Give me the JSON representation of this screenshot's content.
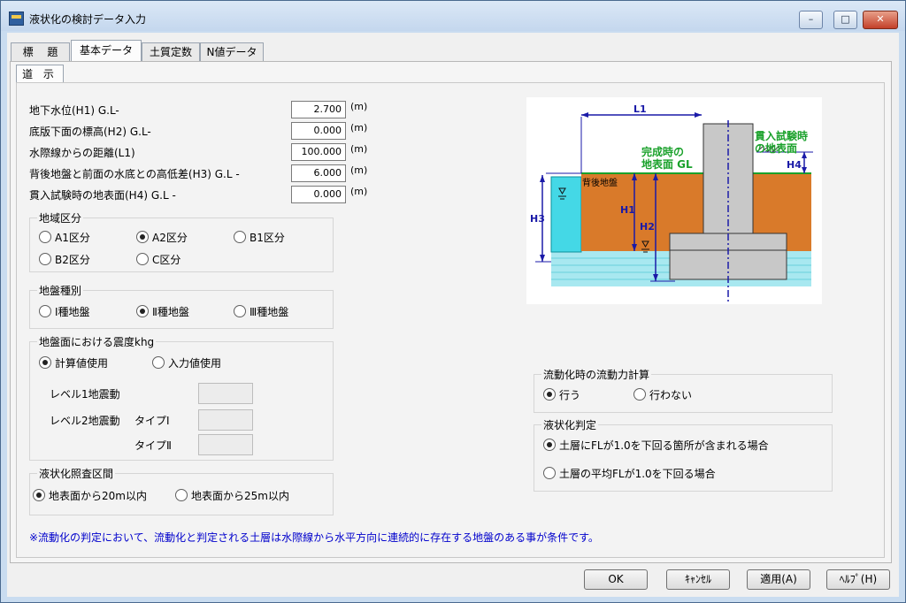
{
  "window": {
    "title": "液状化の検討データ入力"
  },
  "tabs": [
    {
      "label": "標　 題"
    },
    {
      "label": "基本データ"
    },
    {
      "label": "土質定数"
    },
    {
      "label": "N値データ"
    }
  ],
  "subtab": "道 示",
  "fields": [
    {
      "label": "地下水位(H1)  G.L-",
      "value": "2.700",
      "unit": "(m)"
    },
    {
      "label": "底版下面の標高(H2)  G.L-",
      "value": "0.000",
      "unit": "(m)"
    },
    {
      "label": "水際線からの距離(L1)",
      "value": "100.000",
      "unit": "(m)"
    },
    {
      "label": "背後地盤と前面の水底との高低差(H3)  G.L -",
      "value": "6.000",
      "unit": "(m)"
    },
    {
      "label": "貫入試験時の地表面(H4)  G.L -",
      "value": "0.000",
      "unit": "(m)"
    }
  ],
  "region": {
    "title": "地域区分",
    "options": [
      "A1区分",
      "A2区分",
      "B1区分",
      "B2区分",
      "C区分"
    ],
    "selected": "A2区分"
  },
  "ground": {
    "title": "地盤種別",
    "options": [
      "Ⅰ種地盤",
      "Ⅱ種地盤",
      "Ⅲ種地盤"
    ],
    "selected": "Ⅱ種地盤"
  },
  "seismic": {
    "title": "地盤面における震度khg",
    "options": [
      "計算値使用",
      "入力値使用"
    ],
    "selected": "計算値使用",
    "level1": "レベル1地震動",
    "level2": "レベル2地震動",
    "type1": "タイプⅠ",
    "type2": "タイプⅡ"
  },
  "range": {
    "title": "液状化照査区間",
    "options": [
      "地表面から20m以内",
      "地表面から25m以内"
    ],
    "selected": "地表面から20m以内"
  },
  "flow": {
    "title": "流動化時の流動力計算",
    "options": [
      "行う",
      "行わない"
    ],
    "selected": "行う"
  },
  "judgement": {
    "title": "液状化判定",
    "options": [
      "土層にFLが1.0を下回る箇所が含まれる場合",
      "土層の平均FLが1.0を下回る場合"
    ],
    "selected": "土層にFLが1.0を下回る箇所が含まれる場合"
  },
  "diagram": {
    "l1": "L1",
    "h1": "H1",
    "h2": "H2",
    "h3": "H3",
    "h4": "H4",
    "back_ground": "背後地盤",
    "completion_surface_1": "完成時の",
    "completion_surface_2": "地表面 GL",
    "test_surface_1": "貫入試験時",
    "test_surface_2": "の地表面",
    "colors": {
      "soil": "#d97a2a",
      "water": "#44d8e6",
      "pale_water": "#a8e8f0",
      "structure": "#c8c8c8",
      "green": "#1aa12b",
      "blue": "#1a1aa8"
    }
  },
  "note": "※流動化の判定において、流動化と判定される土層は水際線から水平方向に連続的に存在する地盤のある事が条件です。",
  "buttons": {
    "ok": "OK",
    "cancel": "ｷｬﾝｾﾙ",
    "apply": "適用(A)",
    "help": "ﾍﾙﾌﾟ(H)"
  },
  "titlebar_buttons": {
    "minimize": "–",
    "maximize": "□",
    "close": "✕"
  }
}
